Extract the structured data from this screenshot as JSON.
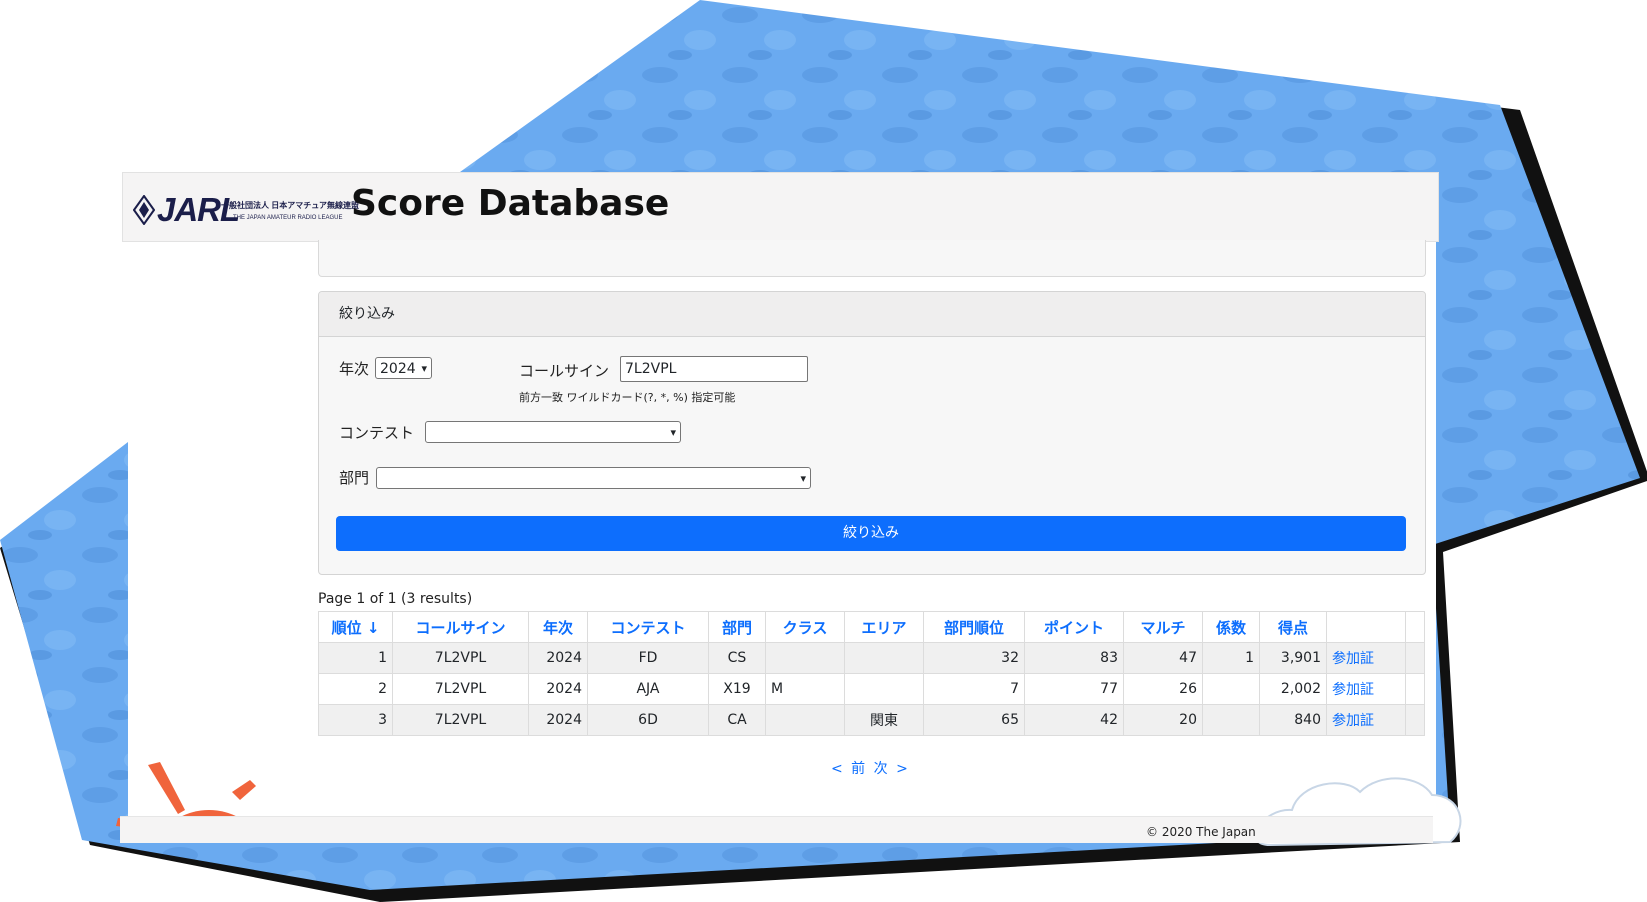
{
  "header": {
    "logo_word": "JARL",
    "logo_sub_jp": "一般社団法人 日本アマチュア無線連盟",
    "logo_sub_en": "THE JAPAN AMATEUR RADIO LEAGUE",
    "title": "Score Database"
  },
  "filter": {
    "title": "絞り込み",
    "year_label": "年次",
    "year_value": "2024",
    "callsign_label": "コールサイン",
    "callsign_value": "7L2VPL",
    "callsign_hint": "前方一致 ワイルドカード(?, *, %) 指定可能",
    "contest_label": "コンテスト",
    "contest_value": "",
    "category_label": "部門",
    "category_value": "",
    "submit_label": "絞り込み"
  },
  "page_info": "Page 1 of 1 (3 results)",
  "table": {
    "headers": [
      "順位 ↓",
      "コールサイン",
      "年次",
      "コンテスト",
      "部門",
      "クラス",
      "エリア",
      "部門順位",
      "ポイント",
      "マルチ",
      "係数",
      "得点",
      ""
    ],
    "rows": [
      [
        "1",
        "7L2VPL",
        "2024",
        "FD",
        "CS",
        "",
        "",
        "32",
        "83",
        "47",
        "1",
        "3,901",
        "参加証"
      ],
      [
        "2",
        "7L2VPL",
        "2024",
        "AJA",
        "X19",
        "M",
        "",
        "7",
        "77",
        "26",
        "",
        "2,002",
        "参加証"
      ],
      [
        "3",
        "7L2VPL",
        "2024",
        "6D",
        "CA",
        "",
        "関東",
        "65",
        "42",
        "20",
        "",
        "840",
        "参加証"
      ]
    ]
  },
  "pager": {
    "prev": "< 前",
    "next": "次 >"
  },
  "footer": {
    "copyright": "© 2020 The Japan"
  },
  "colors": {
    "accent": "#0d6efd",
    "sky": "#6aaaf0"
  }
}
